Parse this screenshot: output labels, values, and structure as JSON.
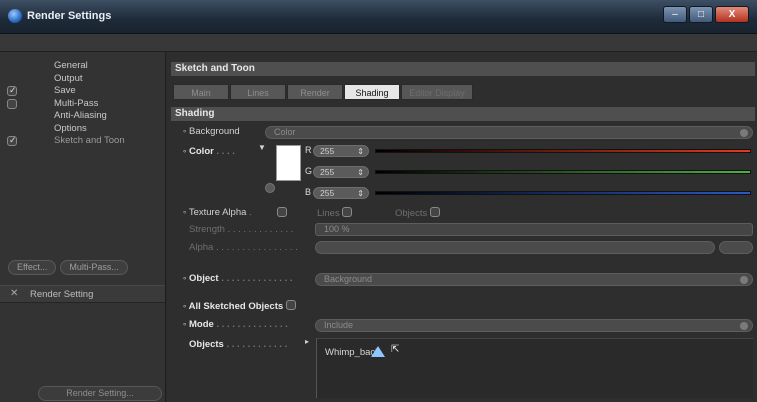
{
  "window": {
    "title": "Render Settings",
    "buttons": {
      "minimize": "–",
      "maximize": "□",
      "close": "X"
    }
  },
  "nav": {
    "items": [
      {
        "label": "General",
        "check": false
      },
      {
        "label": "Output",
        "check": false
      },
      {
        "label": "Save",
        "check": true
      },
      {
        "label": "Multi-Pass",
        "check": true
      },
      {
        "label": "Anti-Aliasing",
        "check": false
      },
      {
        "label": "Options",
        "check": false
      },
      {
        "label": "Sketch and Toon",
        "check": true
      }
    ],
    "effect_button": "Effect...",
    "multipass_button": "Multi-Pass...",
    "render_setting_item": "Render Setting",
    "render_setting_button": "Render Setting..."
  },
  "panel": {
    "title": "Sketch and Toon",
    "tabs": [
      "Main",
      "Lines",
      "Render",
      "Shading",
      "Editor Display"
    ],
    "active_tab": "Shading",
    "section": "Shading",
    "background_label": "Background",
    "background_value": "Color",
    "color_label": "Color",
    "channels": [
      {
        "name": "R",
        "value": "255",
        "color": "#e23a1e"
      },
      {
        "name": "G",
        "value": "255",
        "color": "#4fb043"
      },
      {
        "name": "B",
        "value": "255",
        "color": "#2c58c8"
      }
    ],
    "swatch_color": "#ffffff",
    "texture_alpha_label": "Texture Alpha",
    "lines_label": "Lines",
    "objects_label": "Objects",
    "strength_label": "Strength",
    "strength_value": "100 %",
    "alpha_label": "Alpha",
    "object_label": "Object",
    "object_value": "Background",
    "all_sketched_label": "All Sketched Objects",
    "mode_label": "Mode",
    "mode_value": "Include",
    "objects_list_label": "Objects",
    "objects_entry": "Whimp_back"
  }
}
